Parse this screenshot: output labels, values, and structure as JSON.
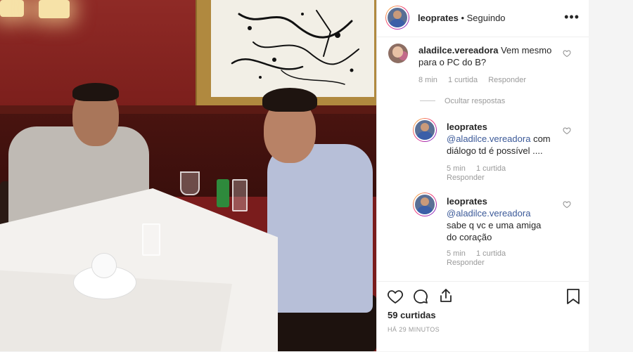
{
  "post": {
    "username": "leoprates",
    "follow_status": "• Seguindo",
    "likes": "59 curtidas",
    "posted_ago": "HÁ 29 MINUTOS"
  },
  "comments": [
    {
      "username": "aladilce.vereadora",
      "text": "Vem mesmo para o PC do B?",
      "time": "8 min",
      "likes": "1 curtida",
      "reply": "Responder"
    }
  ],
  "hide_replies": "Ocultar respostas",
  "replies": [
    {
      "username": "leoprates",
      "mention": "@aladilce.vereadora",
      "text": "com diálogo td é possível ....",
      "time": "5 min",
      "likes": "1 curtida",
      "reply": "Responder"
    },
    {
      "username": "leoprates",
      "mention": "@aladilce.vereadora",
      "text": "sabe q vc e uma amiga do coração",
      "time": "5 min",
      "likes": "1 curtida",
      "reply": "Responder"
    }
  ],
  "icons": {
    "more": "more-options-icon",
    "like": "heart-icon",
    "comment": "comment-icon",
    "share": "share-icon",
    "save": "bookmark-icon"
  },
  "colors": {
    "mention": "#3b5998",
    "muted": "#8e8e8e",
    "text": "#262626"
  }
}
